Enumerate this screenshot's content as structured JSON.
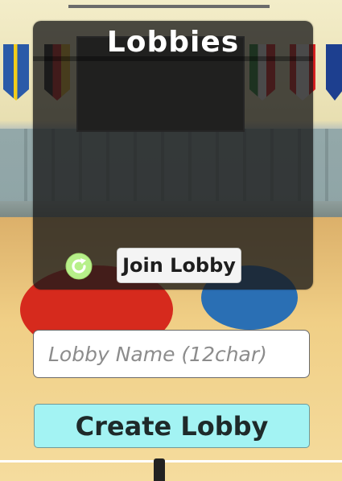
{
  "panel": {
    "title": "Lobbies"
  },
  "controls": {
    "refresh_icon": "refresh-icon",
    "join_label": "Join Lobby",
    "lobby_name_placeholder": "Lobby Name (12char)",
    "lobby_name_value": "",
    "create_label": "Create Lobby"
  },
  "colors": {
    "panel_bg": "#191919",
    "create_button_bg": "#a3f3f3",
    "refresh_icon": "#b7f08a"
  }
}
